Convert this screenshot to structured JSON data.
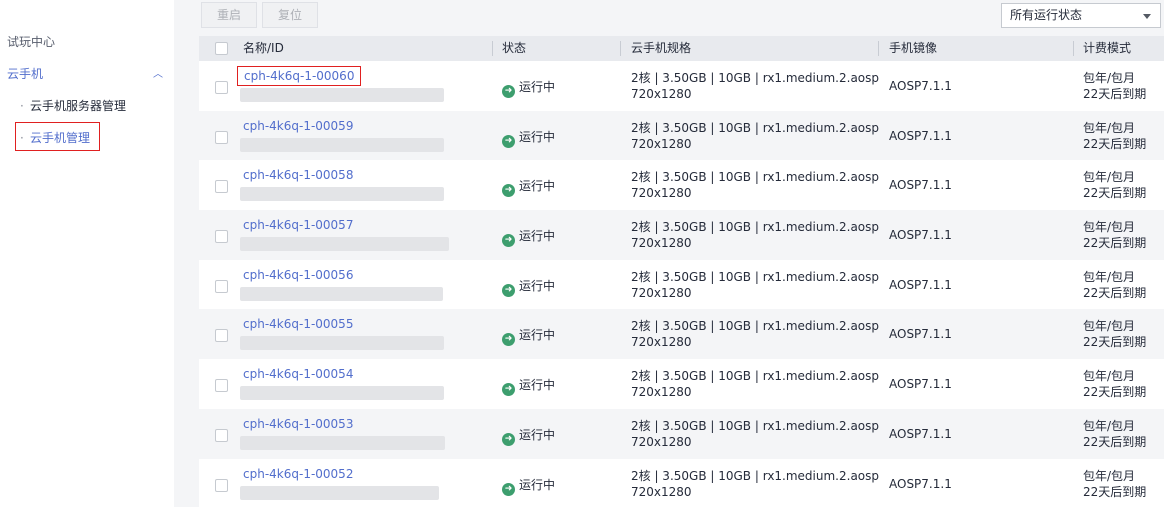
{
  "sidebar": {
    "group_title": "试玩中心",
    "section": "云手机",
    "items": [
      {
        "label": "云手机服务器管理"
      },
      {
        "label": "云手机管理"
      }
    ]
  },
  "toolbar": {
    "restart_label": "重启",
    "reset_label": "复位",
    "filter_value": "所有运行状态"
  },
  "table": {
    "columns": [
      "名称/ID",
      "状态",
      "云手机规格",
      "手机镜像",
      "计费模式"
    ],
    "rows": [
      {
        "name": "cph-4k6q-1-00060",
        "status": "运行中",
        "spec_line1": "2核 | 3.50GB | 10GB | rx1.medium.2.aosp",
        "spec_line2": "720x1280",
        "image": "AOSP7.1.1",
        "billing_line1": "包年/包月",
        "billing_line2": "22天后到期"
      },
      {
        "name": "cph-4k6q-1-00059",
        "status": "运行中",
        "spec_line1": "2核 | 3.50GB | 10GB | rx1.medium.2.aosp",
        "spec_line2": "720x1280",
        "image": "AOSP7.1.1",
        "billing_line1": "包年/包月",
        "billing_line2": "22天后到期"
      },
      {
        "name": "cph-4k6q-1-00058",
        "status": "运行中",
        "spec_line1": "2核 | 3.50GB | 10GB | rx1.medium.2.aosp",
        "spec_line2": "720x1280",
        "image": "AOSP7.1.1",
        "billing_line1": "包年/包月",
        "billing_line2": "22天后到期"
      },
      {
        "name": "cph-4k6q-1-00057",
        "status": "运行中",
        "spec_line1": "2核 | 3.50GB | 10GB | rx1.medium.2.aosp",
        "spec_line2": "720x1280",
        "image": "AOSP7.1.1",
        "billing_line1": "包年/包月",
        "billing_line2": "22天后到期"
      },
      {
        "name": "cph-4k6q-1-00056",
        "status": "运行中",
        "spec_line1": "2核 | 3.50GB | 10GB | rx1.medium.2.aosp",
        "spec_line2": "720x1280",
        "image": "AOSP7.1.1",
        "billing_line1": "包年/包月",
        "billing_line2": "22天后到期"
      },
      {
        "name": "cph-4k6q-1-00055",
        "status": "运行中",
        "spec_line1": "2核 | 3.50GB | 10GB | rx1.medium.2.aosp",
        "spec_line2": "720x1280",
        "image": "AOSP7.1.1",
        "billing_line1": "包年/包月",
        "billing_line2": "22天后到期"
      },
      {
        "name": "cph-4k6q-1-00054",
        "status": "运行中",
        "spec_line1": "2核 | 3.50GB | 10GB | rx1.medium.2.aosp",
        "spec_line2": "720x1280",
        "image": "AOSP7.1.1",
        "billing_line1": "包年/包月",
        "billing_line2": "22天后到期"
      },
      {
        "name": "cph-4k6q-1-00053",
        "status": "运行中",
        "spec_line1": "2核 | 3.50GB | 10GB | rx1.medium.2.aosp",
        "spec_line2": "720x1280",
        "image": "AOSP7.1.1",
        "billing_line1": "包年/包月",
        "billing_line2": "22天后到期"
      },
      {
        "name": "cph-4k6q-1-00052",
        "status": "运行中",
        "spec_line1": "2核 | 3.50GB | 10GB | rx1.medium.2.aosp",
        "spec_line2": "720x1280",
        "image": "AOSP7.1.1",
        "billing_line1": "包年/包月",
        "billing_line2": "22天后到期"
      }
    ]
  }
}
